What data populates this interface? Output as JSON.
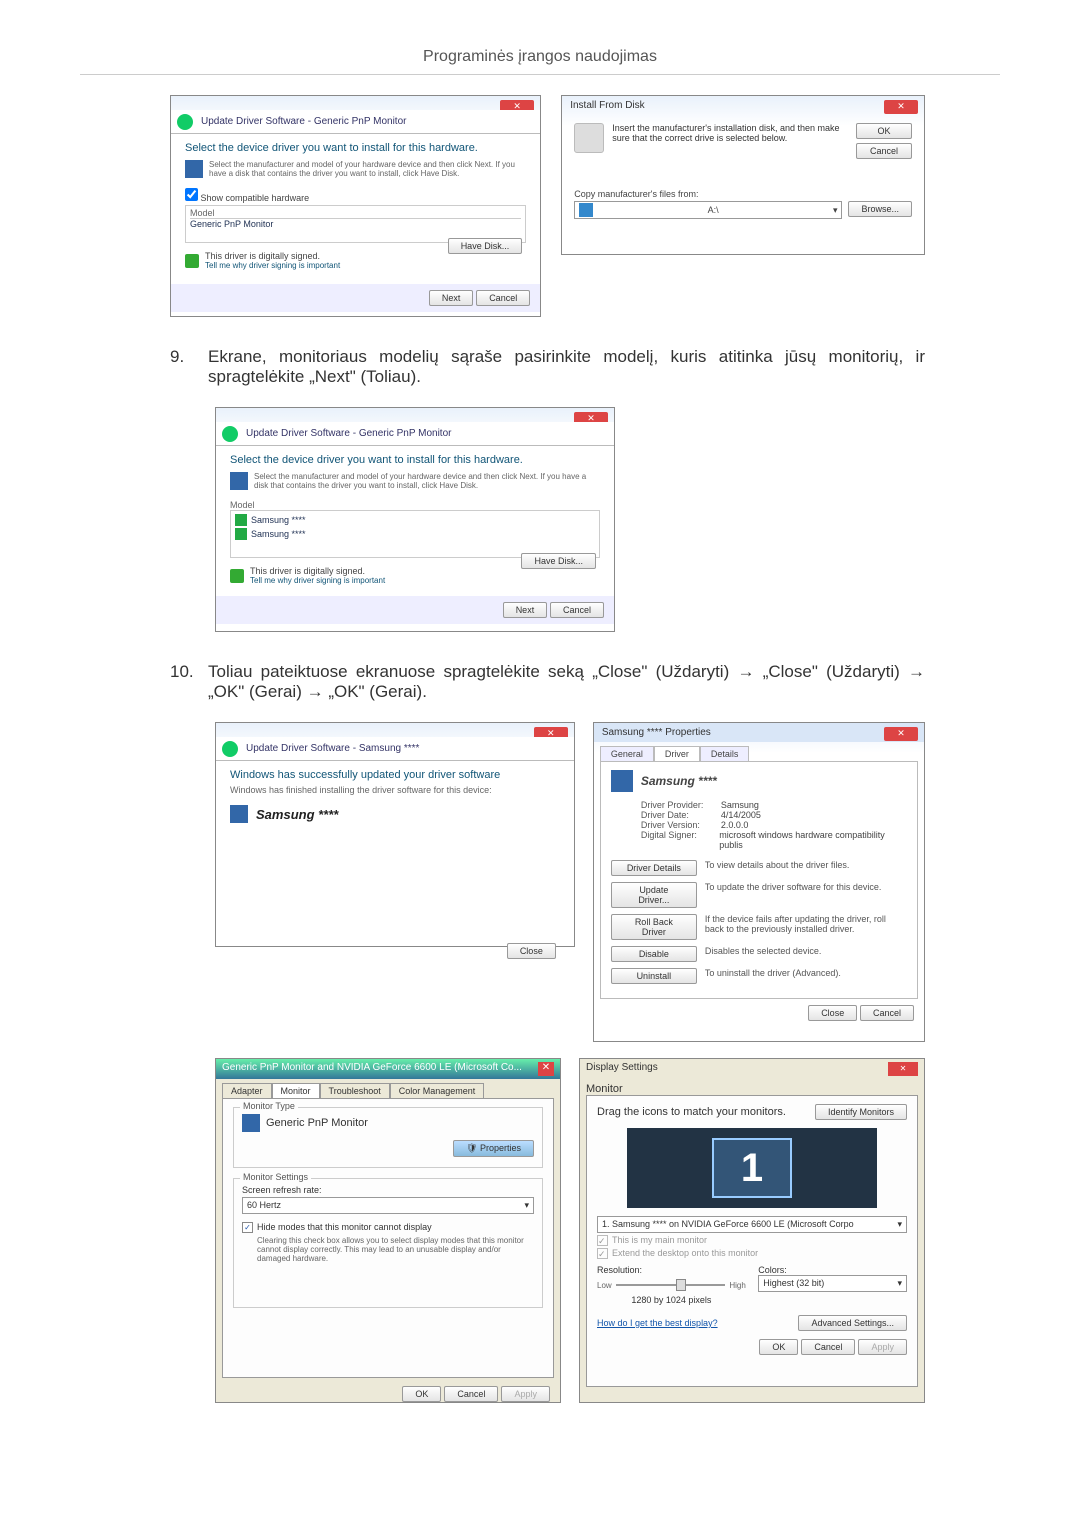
{
  "page": {
    "header": "Programinės įrangos naudojimas"
  },
  "step9": {
    "num": "9.",
    "text": "Ekrane, monitoriaus modelių sąraše pasirinkite modelį, kuris atitinka jūsų monitorių, ir spragtelėkite „Next\" (Toliau)."
  },
  "step10": {
    "num": "10.",
    "text": "Toliau pateiktuose ekranuose spragtelėkite seką „Close\" (Uždaryti) → „Close\" (Uždaryti) → „OK\" (Gerai) → „OK\" (Gerai)."
  },
  "winA": {
    "title": "Update Driver Software - Generic PnP Monitor",
    "heading": "Select the device driver you want to install for this hardware.",
    "sub": "Select the manufacturer and model of your hardware device and then click Next. If you have a disk that contains the driver you want to install, click Have Disk.",
    "show_compat": "Show compatible hardware",
    "model_hdr": "Model",
    "model_sel": "Generic PnP Monitor",
    "signed": "This driver is digitally signed.",
    "tell": "Tell me why driver signing is important",
    "have_disk": "Have Disk...",
    "next": "Next",
    "cancel": "Cancel"
  },
  "winB": {
    "title": "Install From Disk",
    "msg": "Insert the manufacturer's installation disk, and then make sure that the correct drive is selected below.",
    "ok": "OK",
    "cancel": "Cancel",
    "copy": "Copy manufacturer's files from:",
    "a5": "A:\\",
    "browse": "Browse..."
  },
  "winC": {
    "title": "Update Driver Software - Generic PnP Monitor",
    "heading": "Select the device driver you want to install for this hardware.",
    "sub": "Select the manufacturer and model of your hardware device and then click Next. If you have a disk that contains the driver you want to install, click Have Disk.",
    "model_hdr": "Model",
    "m1": "Samsung ****",
    "m2": "Samsung ****",
    "signed": "This driver is digitally signed.",
    "tell": "Tell me why driver signing is important",
    "have_disk": "Have Disk...",
    "next": "Next",
    "cancel": "Cancel"
  },
  "winD": {
    "title": "Update Driver Software - Samsung ****",
    "heading": "Windows has successfully updated your driver software",
    "sub": "Windows has finished installing the driver software for this device:",
    "device": "Samsung ****",
    "close": "Close"
  },
  "winE": {
    "title": "Samsung **** Properties",
    "tabs": {
      "general": "General",
      "driver": "Driver",
      "details": "Details"
    },
    "device": "Samsung ****",
    "rows": {
      "provider_l": "Driver Provider:",
      "provider_v": "Samsung",
      "date_l": "Driver Date:",
      "date_v": "4/14/2005",
      "version_l": "Driver Version:",
      "version_v": "2.0.0.0",
      "signer_l": "Digital Signer:",
      "signer_v": "microsoft windows hardware compatibility publis"
    },
    "btns": {
      "details": "Driver Details",
      "details_d": "To view details about the driver files.",
      "update": "Update Driver...",
      "update_d": "To update the driver software for this device.",
      "rollback": "Roll Back Driver",
      "rollback_d": "If the device fails after updating the driver, roll back to the previously installed driver.",
      "disable": "Disable",
      "disable_d": "Disables the selected device.",
      "uninstall": "Uninstall",
      "uninstall_d": "To uninstall the driver (Advanced)."
    },
    "close": "Close",
    "cancel": "Cancel"
  },
  "winF": {
    "title": "Generic PnP Monitor and NVIDIA GeForce 6600 LE (Microsoft Co...",
    "tabs": {
      "adapter": "Adapter",
      "monitor": "Monitor",
      "trouble": "Troubleshoot",
      "color": "Color Management"
    },
    "monitor_type": "Monitor Type",
    "monitor_name": "Generic PnP Monitor",
    "properties": "Properties",
    "settings": "Monitor Settings",
    "refresh_l": "Screen refresh rate:",
    "refresh_v": "60 Hertz",
    "hide": "Hide modes that this monitor cannot display",
    "hide_desc": "Clearing this check box allows you to select display modes that this monitor cannot display correctly. This may lead to an unusable display and/or damaged hardware.",
    "ok": "OK",
    "cancel": "Cancel",
    "apply": "Apply"
  },
  "winG": {
    "title": "Display Settings",
    "tab": "Monitor",
    "drag": "Drag the icons to match your monitors.",
    "identify": "Identify Monitors",
    "mon1": "1",
    "sel": "1. Samsung **** on NVIDIA GeForce 6600 LE (Microsoft Corpo",
    "chk1": "This is my main monitor",
    "chk2": "Extend the desktop onto this monitor",
    "res_l": "Resolution:",
    "low": "Low",
    "high": "High",
    "res_v": "1280 by 1024 pixels",
    "col_l": "Colors:",
    "col_v": "Highest (32 bit)",
    "howlink": "How do I get the best display?",
    "adv": "Advanced Settings...",
    "ok": "OK",
    "cancel": "Cancel",
    "apply": "Apply"
  }
}
